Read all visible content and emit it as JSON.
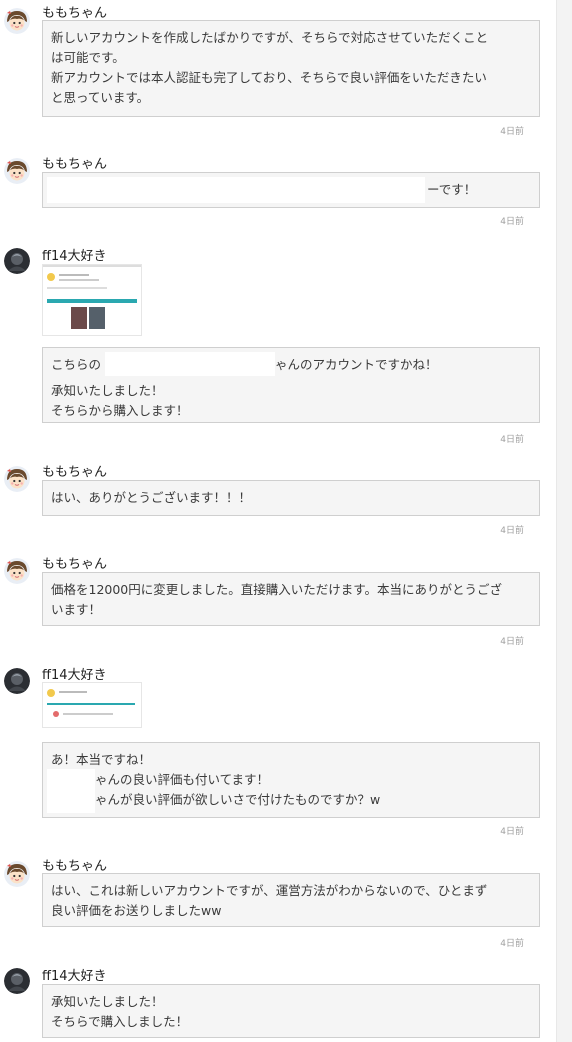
{
  "users": {
    "momo": "ももちゃん",
    "ff": "ff14大好き"
  },
  "icons": {
    "momo_avatar": "girl-avatar-icon",
    "ff_avatar": "dark-avatar-icon"
  },
  "colors": {
    "bubble_bg": "#f5f5f5",
    "bubble_border": "#cfcfcf",
    "timestamp": "#a0a0a0",
    "thumb_accent": "#2aa8b0"
  },
  "messages": [
    {
      "user": "ももちゃん",
      "lines": [
        "新しいアカウントを作成したばかりですが、そちらで対応させていただくこと",
        "は可能です。",
        "新アカウントでは本人認証も完了しており、そちらで良い評価をいただきたい",
        "と思っています。"
      ],
      "time": "4日前"
    },
    {
      "user": "ももちゃん",
      "lines": [
        "ーです！"
      ],
      "time": "4日前"
    },
    {
      "user": "ff14大好き",
      "lines": [
        "こちらの",
        "ゃんのアカウントですかね！",
        "承知いたしました！",
        "そちらから購入します！"
      ],
      "time": "4日前"
    },
    {
      "user": "ももちゃん",
      "lines": [
        "はい、ありがとうございます！！！"
      ],
      "time": "4日前"
    },
    {
      "user": "ももちゃん",
      "lines": [
        "価格を12000円に変更しました。直接購入いただけます。本当にありがとうござ",
        "います！"
      ],
      "time": "4日前"
    },
    {
      "user": "ff14大好き",
      "lines": [
        "あ！本当ですね！",
        "ゃんの良い評価も付いてます！",
        "ゃんが良い評価が欲しいさで付けたものですか？w"
      ],
      "time": "4日前"
    },
    {
      "user": "ももちゃん",
      "lines": [
        "はい、これは新しいアカウントですが、運営方法がわからないので、ひとまず",
        "良い評価をお送りしましたww"
      ],
      "time": "4日前"
    },
    {
      "user": "ff14大好き",
      "lines": [
        "承知いたしました！",
        "そちらで購入しました！"
      ]
    }
  ]
}
